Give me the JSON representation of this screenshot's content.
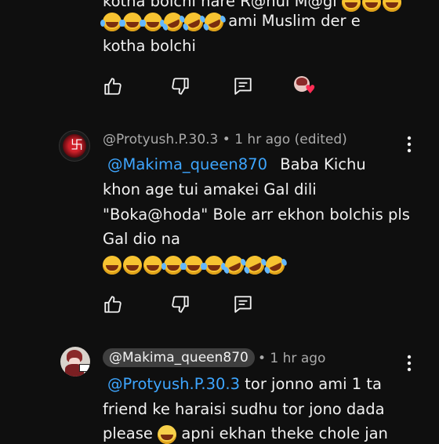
{
  "comment1": {
    "text_line_top": "kotha bolchi hare R@hul M@gi",
    "text_line2": "ami Muslim der e",
    "text_line3": "kotha bolchi"
  },
  "comment2": {
    "author": "@Protyush.P.30.3",
    "meta": "• 1 hr ago (edited)",
    "mention": "@Makima_queen870",
    "text_1": "Baba Kichu",
    "text_2": "khon age tui amakei Gal dili",
    "text_3": "\"Boka@hoda\" Bole arr ekhon bolchis pls",
    "text_4": "Gal dio na"
  },
  "comment3": {
    "author": "@Makima_queen870",
    "meta": "• 1 hr ago",
    "mention": "@Protyush.P.30.3",
    "text_1": "tor jonno ami 1 ta",
    "text_2": "friend ke haraisi sudhu tor jono dada",
    "text_3a": "please",
    "text_3b": "apni ekhan theke chole jan"
  },
  "icons": {
    "like": "thumbs-up-icon",
    "dislike": "thumbs-down-icon",
    "reply": "reply-comment-icon",
    "more": "more-vertical-icon",
    "heart": "creator-heart-icon"
  },
  "colors": {
    "background": "#0f0f0f",
    "text": "#f1f1f1",
    "secondary": "#aaaaaa",
    "mention": "#3ea6ff",
    "chip": "#3f3f3f"
  }
}
